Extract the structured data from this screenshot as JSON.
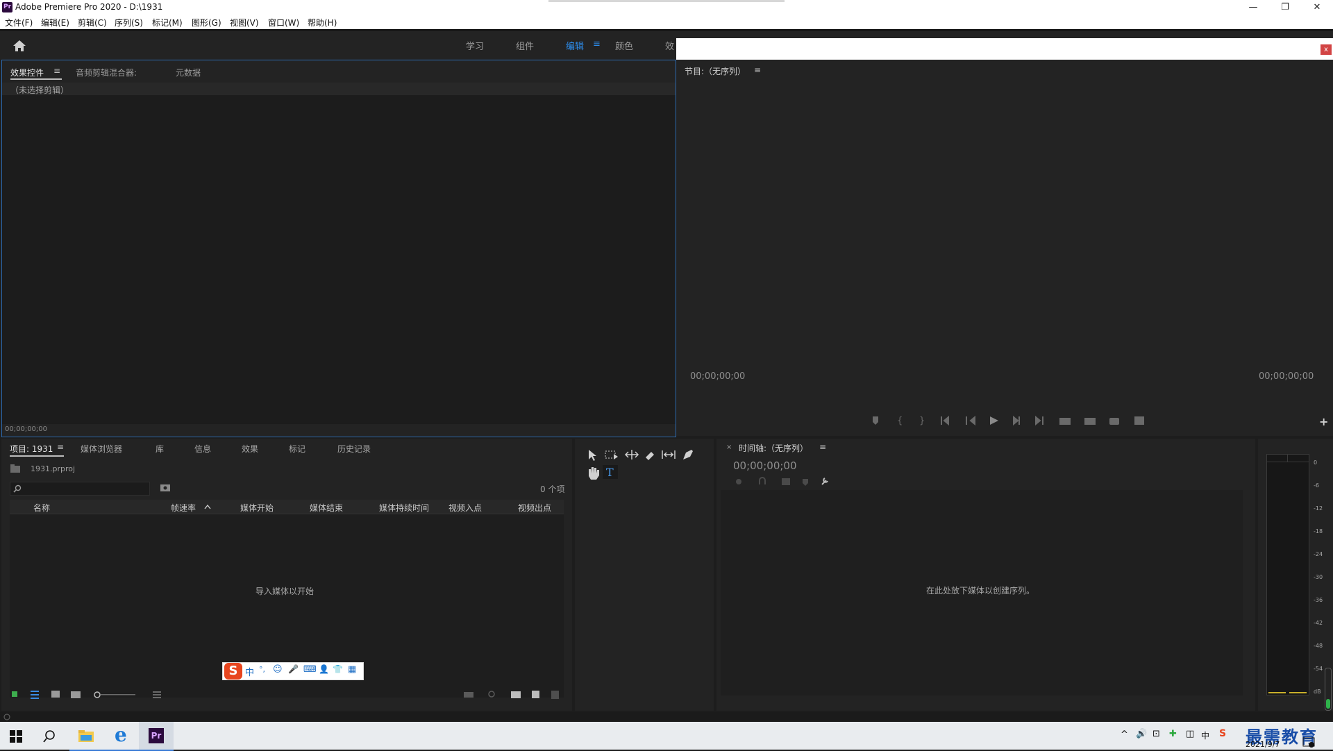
{
  "app": {
    "logo_text": "Pr",
    "title": "Adobe Premiere Pro 2020 - D:\\1931",
    "window_controls": {
      "minimize": "—",
      "restore": "❐",
      "close": "✕"
    }
  },
  "menu": [
    "文件(F)",
    "编辑(E)",
    "剪辑(C)",
    "序列(S)",
    "标记(M)",
    "图形(G)",
    "视图(V)",
    "窗口(W)",
    "帮助(H)"
  ],
  "workspaces": {
    "tabs": [
      "学习",
      "组件",
      "编辑",
      "颜色",
      "效"
    ],
    "active": "编辑",
    "menu_glyph": "≡"
  },
  "effect_panel": {
    "tabs": [
      "效果控件",
      "音频剪辑混合器:",
      "元数据"
    ],
    "menu_glyph": "≡",
    "no_clip": "（未选择剪辑）",
    "timecode": "00;00;00;00"
  },
  "program_monitor": {
    "title": "节目:（无序列）",
    "menu_glyph": "≡",
    "timecode_left": "00;00;00;00",
    "timecode_right": "00;00;00;00",
    "close_glyph": "x",
    "add_glyph": "+"
  },
  "project_panel": {
    "tabs": [
      "项目: 1931",
      "媒体浏览器",
      "库",
      "信息",
      "效果",
      "标记",
      "历史记录"
    ],
    "menu_glyph": "≡",
    "file": "1931.prproj",
    "count": "0 个项",
    "columns": [
      "名称",
      "帧速率",
      "媒体开始",
      "媒体结束",
      "媒体持续时间",
      "视频入点",
      "视频出点"
    ],
    "empty_hint": "导入媒体以开始"
  },
  "timeline": {
    "close_glyph": "×",
    "title": "时间轴:（无序列）",
    "menu_glyph": "≡",
    "timecode": "00;00;00;00",
    "empty_hint": "在此处放下媒体以创建序列。"
  },
  "audio_meter": {
    "ticks": [
      "0",
      "-6",
      "-12",
      "-18",
      "-24",
      "-30",
      "-36",
      "-42",
      "-48",
      "-54",
      "dB"
    ]
  },
  "ime_bar": {
    "logo": "S",
    "items": [
      "中",
      "°,",
      "☺",
      "🎤",
      "⌨",
      "👤",
      "👕",
      "▦"
    ]
  },
  "taskbar": {
    "date": "2021/9/7",
    "watermark": "最需教育",
    "pr_label": "Pr",
    "ie_label": "e",
    "tray": [
      "^",
      "🔊",
      "⊡",
      "✚",
      "◫",
      "中",
      "S"
    ]
  },
  "colors": {
    "accent": "#2d8ceb",
    "panel": "#232323",
    "bg": "#1d1d1d"
  }
}
